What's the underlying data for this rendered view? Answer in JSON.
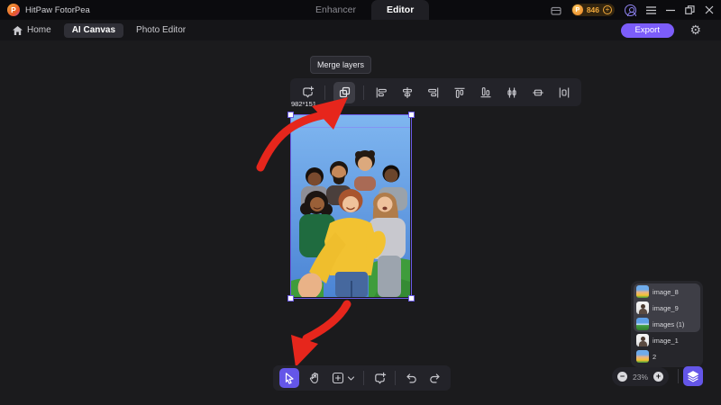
{
  "app": {
    "name": "HitPaw FotorPea"
  },
  "titlebar": {
    "tabs": [
      {
        "label": "Enhancer",
        "active": false
      },
      {
        "label": "Editor",
        "active": true
      }
    ],
    "credits": "846",
    "window_icons": [
      "gift-icon",
      "menu-icon",
      "minimize-icon",
      "restore-icon",
      "close-icon"
    ]
  },
  "menubar": {
    "home": "Home",
    "ai_canvas": "AI Canvas",
    "photo_editor": "Photo Editor",
    "export": "Export",
    "icons": [
      "home-icon",
      "gear-icon"
    ]
  },
  "tooltip": {
    "merge_layers": "Merge layers"
  },
  "toolbar_top": {
    "icons": [
      "transform-add",
      "merge-layers",
      "align-left",
      "align-center-horizontal",
      "align-right",
      "align-top",
      "align-bottom",
      "distribute-horizontal-centers",
      "align-middle-vertical",
      "distribute-horizontal-spacing"
    ],
    "active_icon": "merge-layers"
  },
  "toolbar_bottom": {
    "icons": [
      "select-cursor",
      "hand-pan",
      "add-canvas",
      "chevron-down",
      "transform-add",
      "undo",
      "redo"
    ],
    "active_icon": "select-cursor"
  },
  "canvas": {
    "selected_layer_dimensions": "982*151",
    "zoom_percent": "23%"
  },
  "layers_panel": {
    "items": [
      {
        "label": "image_8",
        "selected": true,
        "thumb": "group-photo"
      },
      {
        "label": "image_9",
        "selected": true,
        "thumb": "person-photo"
      },
      {
        "label": "images (1)",
        "selected": true,
        "thumb": "landscape-photo"
      },
      {
        "label": "image_1",
        "selected": false,
        "thumb": "person-photo"
      },
      {
        "label": "2",
        "selected": false,
        "thumb": "group-photo"
      }
    ]
  },
  "colors": {
    "accent_purple": "#7C5DFA",
    "tool_purple": "#6456E8",
    "selection_purple": "#6A5AE8",
    "arrow_red": "#E6261C",
    "credit_gold": "#F2A93B"
  }
}
